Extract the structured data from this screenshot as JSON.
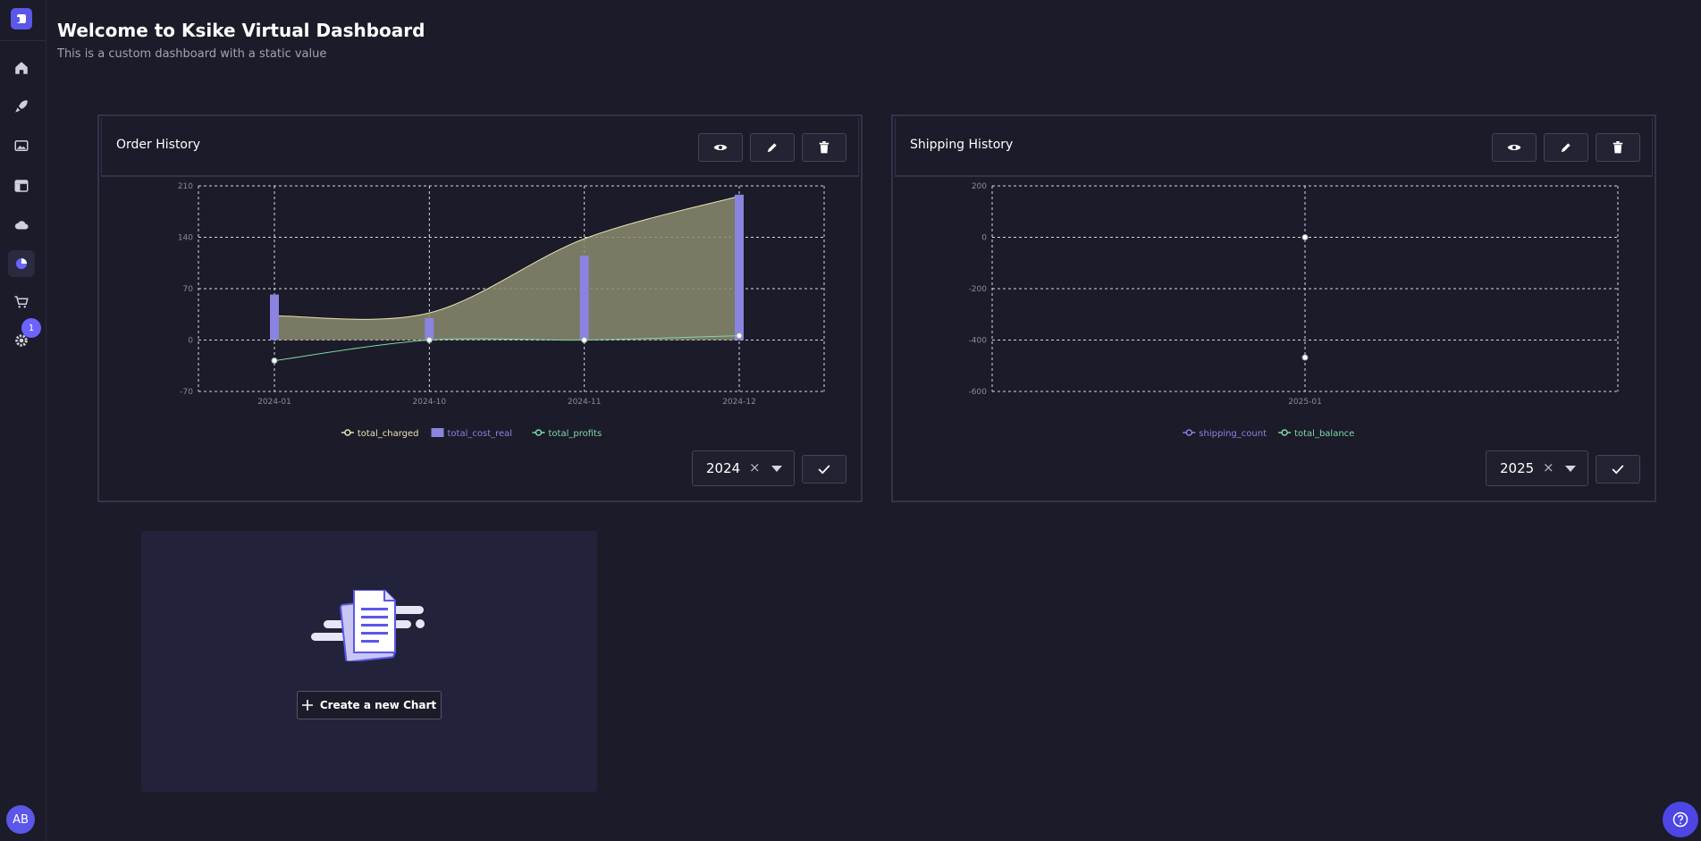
{
  "page": {
    "title": "Welcome to Ksike Virtual Dashboard",
    "subtitle": "This is a custom dashboard with a static value"
  },
  "sidebar": {
    "items": [
      "home-icon",
      "rocket-icon",
      "gallery-icon",
      "layout-icon",
      "cloud-icon",
      "chart-pie-icon",
      "cart-icon",
      "gear-icon"
    ],
    "active": "chart-pie-icon",
    "badge": "1",
    "avatar": "AB"
  },
  "colors": {
    "accent": "#5b57e8",
    "bar": "#8a84e0",
    "area": "#8a8a6e",
    "profit": "#7fd8a4",
    "charged": "#e8e3b2"
  },
  "cards": [
    {
      "title": "Order History",
      "year": "2024"
    },
    {
      "title": "Shipping History",
      "year": "2025"
    }
  ],
  "new_chart": {
    "label": "Create a new Chart"
  },
  "chart_data": [
    {
      "type": "line",
      "categories": [
        "2024-01",
        "2024-10",
        "2024-11",
        "2024-12"
      ],
      "ylim": [
        -70,
        210
      ],
      "yticks": [
        "210",
        "140",
        "70",
        "0",
        "-70"
      ],
      "series": [
        {
          "name": "total_charged",
          "kind": "area",
          "values": [
            33,
            37,
            138,
            196
          ]
        },
        {
          "name": "total_cost_real",
          "kind": "bar",
          "values": [
            62,
            30,
            115,
            198
          ]
        },
        {
          "name": "total_profits",
          "kind": "line",
          "values": [
            -28,
            0,
            0,
            6
          ]
        }
      ],
      "grid": true,
      "legend": "bottom"
    },
    {
      "type": "line",
      "categories": [
        "2025-01"
      ],
      "ylim": [
        -600,
        200
      ],
      "yticks": [
        "200",
        "0",
        "-200",
        "-400",
        "-600"
      ],
      "series": [
        {
          "name": "shipping_count",
          "values": [
            0
          ]
        },
        {
          "name": "total_balance",
          "values": [
            -468
          ]
        }
      ],
      "grid": true,
      "legend": "bottom"
    }
  ]
}
